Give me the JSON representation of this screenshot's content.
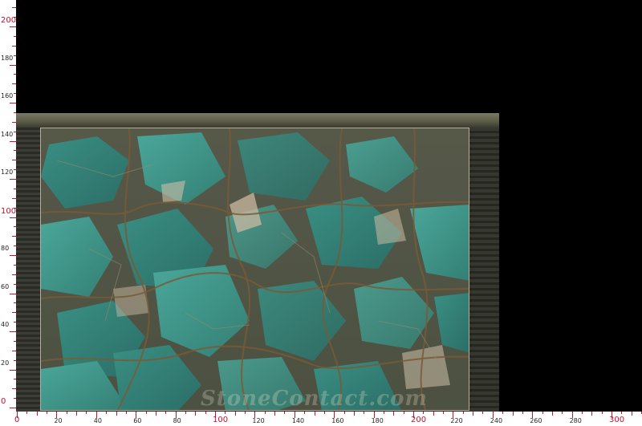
{
  "ruler": {
    "vertical_labels": [
      {
        "text": "0",
        "major": true
      },
      {
        "text": "20",
        "major": false
      },
      {
        "text": "40",
        "major": false
      },
      {
        "text": "60",
        "major": false
      },
      {
        "text": "80",
        "major": false
      },
      {
        "text": "100",
        "major": true
      },
      {
        "text": "120",
        "major": false
      },
      {
        "text": "140",
        "major": false
      },
      {
        "text": "160",
        "major": false
      },
      {
        "text": "180",
        "major": false
      },
      {
        "text": "200",
        "major": true
      }
    ],
    "horizontal_labels": [
      {
        "text": "0",
        "major": true
      },
      {
        "text": "20",
        "major": false
      },
      {
        "text": "40",
        "major": false
      },
      {
        "text": "60",
        "major": false
      },
      {
        "text": "80",
        "major": false
      },
      {
        "text": "100",
        "major": true
      },
      {
        "text": "120",
        "major": false
      },
      {
        "text": "140",
        "major": false
      },
      {
        "text": "160",
        "major": false
      },
      {
        "text": "180",
        "major": false
      },
      {
        "text": "200",
        "major": true
      },
      {
        "text": "220",
        "major": false
      },
      {
        "text": "240",
        "major": false
      },
      {
        "text": "260",
        "major": false
      },
      {
        "text": "280",
        "major": false
      },
      {
        "text": "300",
        "major": true
      }
    ]
  },
  "photo": {
    "subject": "amazonite-slab",
    "colors": {
      "turquoise": "#3f9a8e",
      "brown_vein": "#6b5032",
      "background": "#000000"
    }
  },
  "watermark": {
    "text": "StoneContact.com"
  }
}
